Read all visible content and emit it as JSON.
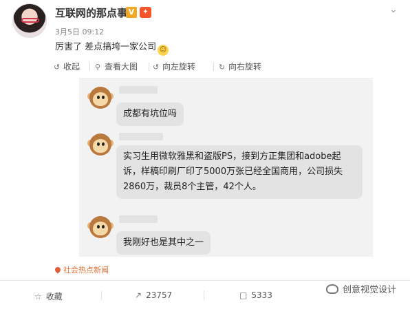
{
  "post": {
    "author": "互联网的那点事",
    "verified_badge": "V",
    "vip_badge": "✦",
    "time": "3月5日 09:12",
    "text": "厉害了 差点搞垮一家公司",
    "emoji": "☺"
  },
  "image_toolbar": {
    "collapse": "收起",
    "view_large": "查看大图",
    "rotate_left": "向左旋转",
    "rotate_right": "向右旋转"
  },
  "chat": {
    "messages": [
      "成都有坑位吗",
      "实习生用微软雅黑和盗版PS，接到方正集团和adobe起",
      "诉，样稿印刷厂印了5000万张已经全国商用，公司损失",
      "2860万，裁员8个主管，42个人。",
      "我刚好也是其中之一"
    ]
  },
  "topic": "社会热点新闻",
  "footer": {
    "favorite_label": "收藏",
    "repost_count": "23757",
    "comment_count": "5333"
  },
  "watermark": "创意视觉设计",
  "colors": {
    "link": "#e0703a",
    "chat_bg": "#f2f2f2",
    "bubble_bg": "#e3e3e3",
    "vip": "#f5542a",
    "verified": "#f5a623"
  }
}
